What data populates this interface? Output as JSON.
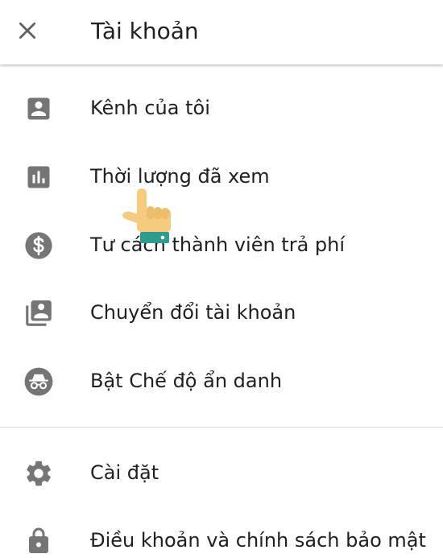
{
  "header": {
    "title": "Tài khoản",
    "close_icon": "close-icon"
  },
  "menu": {
    "items": [
      {
        "label": "Kênh của tôi",
        "icon": "account-box-icon"
      },
      {
        "label": "Thời lượng đã xem",
        "icon": "bar-chart-icon"
      },
      {
        "label": "Tư cách thành viên trả phí",
        "icon": "dollar-icon"
      },
      {
        "label": "Chuyển đổi tài khoản",
        "icon": "switch-account-icon"
      },
      {
        "label": "Bật Chế độ ẩn danh",
        "icon": "incognito-icon"
      }
    ],
    "items2": [
      {
        "label": "Cài đặt",
        "icon": "gear-icon"
      },
      {
        "label": "Điều khoản và chính sách bảo mật",
        "icon": "lock-icon"
      }
    ]
  },
  "overlay": {
    "icon": "pointing-hand-icon"
  },
  "colors": {
    "icon_gray": "#757575",
    "text": "#212121",
    "divider": "#dcdcdc",
    "hand_skin": "#F5CC7F",
    "hand_cuff": "#2E9C8C"
  }
}
